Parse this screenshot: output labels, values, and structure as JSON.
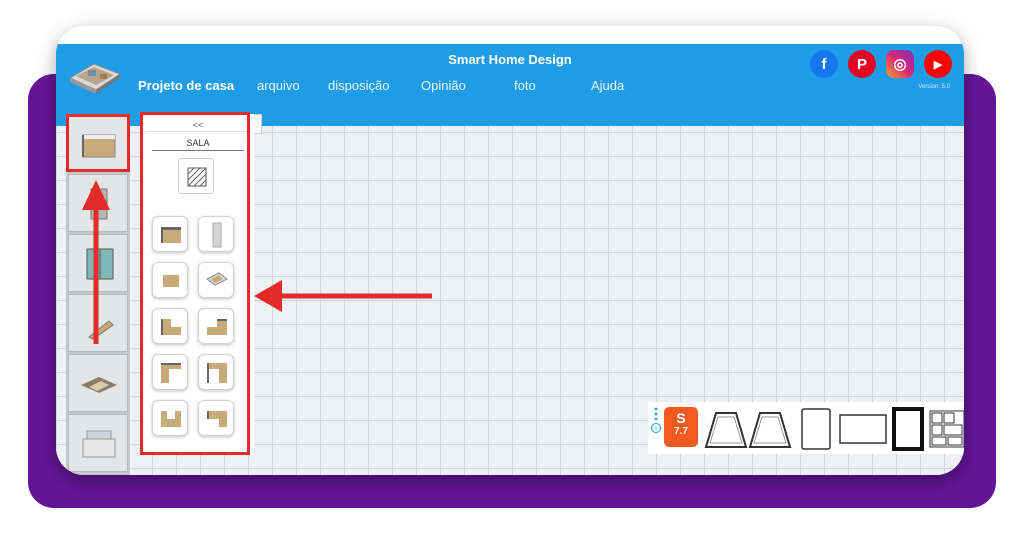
{
  "app": {
    "title": "Smart Home Design",
    "version": "Version: 5.0"
  },
  "menu": {
    "items": [
      {
        "label": "Projeto de casa",
        "active": true
      },
      {
        "label": "arquivo",
        "active": false
      },
      {
        "label": "disposição",
        "active": false
      },
      {
        "label": "Opinião",
        "active": false
      },
      {
        "label": "foto",
        "active": false
      },
      {
        "label": "Ajuda",
        "active": false
      }
    ]
  },
  "social": [
    {
      "icon": "facebook-icon",
      "glyph": "f",
      "color": "#1877f2"
    },
    {
      "icon": "pinterest-icon",
      "glyph": "P",
      "color": "#e60023"
    },
    {
      "icon": "instagram-icon",
      "glyph": "◎",
      "color": "#d62976"
    },
    {
      "icon": "youtube-icon",
      "glyph": "▶",
      "color": "#ff0000"
    }
  ],
  "sidebar": {
    "items": [
      {
        "icon": "room-icon"
      },
      {
        "icon": "door-icon"
      },
      {
        "icon": "window-icon"
      },
      {
        "icon": "stairs-icon"
      },
      {
        "icon": "sofa-icon"
      },
      {
        "icon": "kitchen-icon"
      }
    ]
  },
  "panel": {
    "collapse_label": "<<",
    "section_label": "SALA",
    "floor_tool_icon": "hatched-floor-icon",
    "shapes": [
      {
        "icon": "room-rect-icon"
      },
      {
        "icon": "wall-panel-icon"
      },
      {
        "icon": "floor-tile-icon"
      },
      {
        "icon": "room-open-icon"
      },
      {
        "icon": "room-l-shape-icon"
      },
      {
        "icon": "room-l-shape-alt-icon"
      },
      {
        "icon": "room-l-corner-icon"
      },
      {
        "icon": "room-l-corner-alt-icon"
      },
      {
        "icon": "room-u-shape-icon"
      },
      {
        "icon": "room-notch-icon"
      }
    ]
  },
  "bottom_bar": {
    "badge_text": "S",
    "badge_sub": "7.7",
    "items": [
      {
        "icon": "shopee-badge-icon"
      },
      {
        "icon": "trapezoid-room-icon"
      },
      {
        "icon": "trapezoid-room-alt-icon"
      },
      {
        "icon": "tall-rect-room-icon"
      },
      {
        "icon": "wide-rect-room-icon"
      },
      {
        "icon": "thick-rect-room-icon"
      },
      {
        "icon": "grid-layout-icon"
      }
    ]
  },
  "colors": {
    "topbar": "#1e9ce6",
    "highlight": "#e52a2a",
    "backdrop": "#631596"
  }
}
